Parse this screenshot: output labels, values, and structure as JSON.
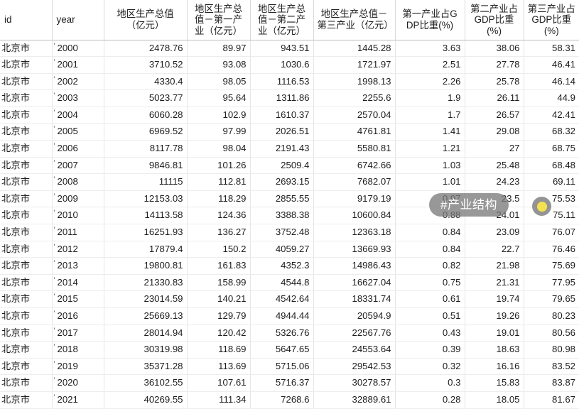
{
  "table": {
    "headers": [
      "id",
      "year",
      "地区生产总值（亿元）",
      "地区生产总值－第一产业（亿元）",
      "地区生产总值－第二产业（亿元）",
      "地区生产总值－第三产业（亿元）",
      "第一产业占GDP比重(%)",
      "第二产业占GDP比重(%)",
      "第三产业占GDP比重(%)"
    ],
    "rows": [
      [
        "北京市",
        "2000",
        "2478.76",
        "89.97",
        "943.51",
        "1445.28",
        "3.63",
        "38.06",
        "58.31"
      ],
      [
        "北京市",
        "2001",
        "3710.52",
        "93.08",
        "1030.6",
        "1721.97",
        "2.51",
        "27.78",
        "46.41"
      ],
      [
        "北京市",
        "2002",
        "4330.4",
        "98.05",
        "1116.53",
        "1998.13",
        "2.26",
        "25.78",
        "46.14"
      ],
      [
        "北京市",
        "2003",
        "5023.77",
        "95.64",
        "1311.86",
        "2255.6",
        "1.9",
        "26.11",
        "44.9"
      ],
      [
        "北京市",
        "2004",
        "6060.28",
        "102.9",
        "1610.37",
        "2570.04",
        "1.7",
        "26.57",
        "42.41"
      ],
      [
        "北京市",
        "2005",
        "6969.52",
        "97.99",
        "2026.51",
        "4761.81",
        "1.41",
        "29.08",
        "68.32"
      ],
      [
        "北京市",
        "2006",
        "8117.78",
        "98.04",
        "2191.43",
        "5580.81",
        "1.21",
        "27",
        "68.75"
      ],
      [
        "北京市",
        "2007",
        "9846.81",
        "101.26",
        "2509.4",
        "6742.66",
        "1.03",
        "25.48",
        "68.48"
      ],
      [
        "北京市",
        "2008",
        "11115",
        "112.81",
        "2693.15",
        "7682.07",
        "1.01",
        "24.23",
        "69.11"
      ],
      [
        "北京市",
        "2009",
        "12153.03",
        "118.29",
        "2855.55",
        "9179.19",
        "0.97",
        "23.5",
        "75.53"
      ],
      [
        "北京市",
        "2010",
        "14113.58",
        "124.36",
        "3388.38",
        "10600.84",
        "0.88",
        "24.01",
        "75.11"
      ],
      [
        "北京市",
        "2011",
        "16251.93",
        "136.27",
        "3752.48",
        "12363.18",
        "0.84",
        "23.09",
        "76.07"
      ],
      [
        "北京市",
        "2012",
        "17879.4",
        "150.2",
        "4059.27",
        "13669.93",
        "0.84",
        "22.7",
        "76.46"
      ],
      [
        "北京市",
        "2013",
        "19800.81",
        "161.83",
        "4352.3",
        "14986.43",
        "0.82",
        "21.98",
        "75.69"
      ],
      [
        "北京市",
        "2014",
        "21330.83",
        "158.99",
        "4544.8",
        "16627.04",
        "0.75",
        "21.31",
        "77.95"
      ],
      [
        "北京市",
        "2015",
        "23014.59",
        "140.21",
        "4542.64",
        "18331.74",
        "0.61",
        "19.74",
        "79.65"
      ],
      [
        "北京市",
        "2016",
        "25669.13",
        "129.79",
        "4944.44",
        "20594.9",
        "0.51",
        "19.26",
        "80.23"
      ],
      [
        "北京市",
        "2017",
        "28014.94",
        "120.42",
        "5326.76",
        "22567.76",
        "0.43",
        "19.01",
        "80.56"
      ],
      [
        "北京市",
        "2018",
        "30319.98",
        "118.69",
        "5647.65",
        "24553.64",
        "0.39",
        "18.63",
        "80.98"
      ],
      [
        "北京市",
        "2019",
        "35371.28",
        "113.69",
        "5715.06",
        "29542.53",
        "0.32",
        "16.16",
        "83.52"
      ],
      [
        "北京市",
        "2020",
        "36102.55",
        "107.61",
        "5716.37",
        "30278.57",
        "0.3",
        "15.83",
        "83.87"
      ],
      [
        "北京市",
        "2021",
        "40269.55",
        "111.34",
        "7268.6",
        "32889.61",
        "0.28",
        "18.05",
        "81.67"
      ]
    ]
  },
  "overlay": {
    "tag_label": "#产业结构",
    "dot_color": "#f5e14f",
    "pill_color": "#787878"
  }
}
